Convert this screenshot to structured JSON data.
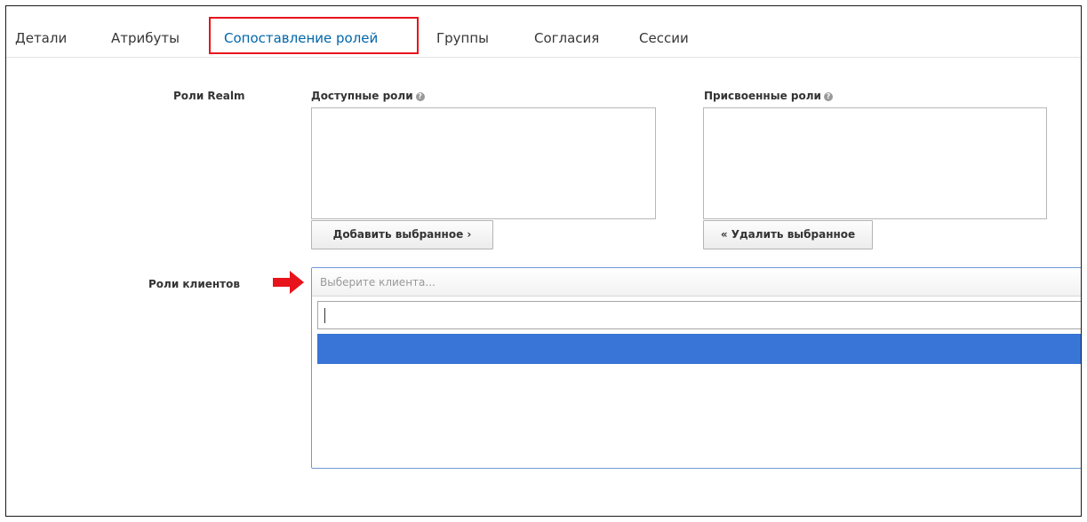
{
  "tabs": [
    {
      "label": "Детали",
      "active": false
    },
    {
      "label": "Атрибуты",
      "active": false
    },
    {
      "label": "Сопоставление ролей",
      "active": true
    },
    {
      "label": "Группы",
      "active": false
    },
    {
      "label": "Согласия",
      "active": false
    },
    {
      "label": "Сессии",
      "active": false
    }
  ],
  "realm_roles": {
    "label": "Роли Realm",
    "available": {
      "label": "Доступные роли",
      "help_icon": "question-circle-icon"
    },
    "assigned": {
      "label": "Присвоенные роли",
      "help_icon": "question-circle-icon"
    },
    "add_button": "Добавить выбранное ›",
    "remove_button": "« Удалить выбранное"
  },
  "client_roles": {
    "label": "Роли клиентов",
    "pointer_icon": "red-arrow-right-icon",
    "select_placeholder": "Выберите клиента...",
    "search_value": ""
  },
  "colors": {
    "active_tab": "#0066a8",
    "highlight_border": "#e8141c",
    "selected_option": "#3875d7",
    "arrow": "#e8141c"
  }
}
